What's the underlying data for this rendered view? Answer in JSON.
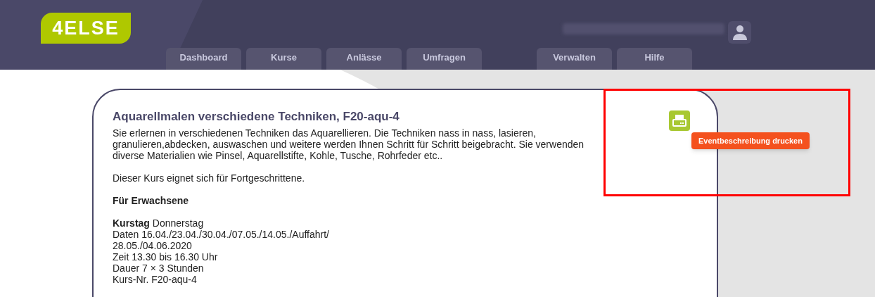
{
  "logo": {
    "text": "4ELSE"
  },
  "nav": {
    "main_tabs": [
      "Dashboard",
      "Kurse",
      "Anlässe",
      "Umfragen"
    ],
    "admin_tabs": [
      "Verwalten",
      "Hilfe"
    ]
  },
  "event": {
    "title": "Aquarellmalen verschiedene Techniken, F20-aqu-4",
    "description": "Sie erlernen in verschiedenen Techniken das Aquarellieren. Die Techniken nass in nass, lasieren, granulieren,abdecken, auswaschen und weitere werden Ihnen Schritt für Schritt beigebracht. Sie verwenden diverse Materialien wie Pinsel, Aquarellstifte, Kohle, Tusche, Rohrfeder etc..",
    "level": "Dieser Kurs eignet sich für Fortgeschrittene.",
    "audience": "Für Erwachsene",
    "details": [
      "**Kurstag** Donnerstag",
      "Daten 16.04./23.04./30.04./07.05./14.05./Auffahrt/",
      "28.05./04.06.2020",
      "Zeit 13.30 bis 16.30 Uhr",
      "Dauer 7 × 3 Stunden",
      "Kurs-Nr. F20-aqu-4"
    ],
    "print_tooltip": "Eventbeschreibung drucken"
  }
}
